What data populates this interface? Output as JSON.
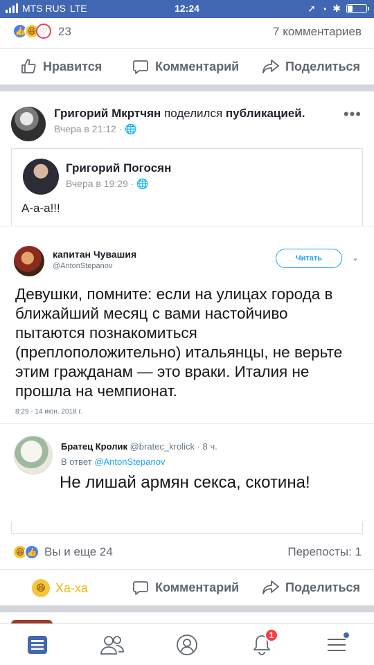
{
  "status_bar": {
    "carrier": "MTS RUS",
    "network": "LTE",
    "time": "12:24",
    "battery_level": 0.25
  },
  "top_reactions": {
    "count": "23",
    "comments": "7 комментариев"
  },
  "actions": {
    "like": "Нравится",
    "comment": "Комментарий",
    "share": "Поделиться"
  },
  "post": {
    "author": "Григорий Мкртчян",
    "shared_text": "поделился",
    "shared_object": "публикацией.",
    "time": "Вчера в 21:12 ·",
    "more": "•••",
    "original": {
      "author": "Григорий Погосян",
      "time": "Вчера в 19:29 ·",
      "text": "А-а-а!!!"
    }
  },
  "tweet": {
    "name": "капитан Чувашия",
    "handle": "@AntonStepanov",
    "follow_label": "Читать",
    "text": "Девушки, помните: если на улицах города в ближайший месяц с вами настойчиво пытаются познакомиться (преплоположительно) итальянцы, не верьте этим гражданам — это враки. Италия не прошла на чемпионат.",
    "date": "8:29 - 14 июн. 2018 г.",
    "reply": {
      "name": "Братец Кролик",
      "handle": "@bratec_krolick · 8 ч.",
      "reply_to_prefix": "В ответ",
      "reply_to": "@AntonStepanov",
      "text": "Не лишай армян секса, скотина!"
    }
  },
  "bottom": {
    "reacted": "Вы и еще 24",
    "reposts": "Перепосты: 1",
    "haha_label": "Ха-ха",
    "comment": "Комментарий",
    "share": "Поделиться"
  },
  "tabbar": {
    "notifications_badge": "1"
  },
  "colors": {
    "brand": "#4267b2",
    "twitter_blue": "#1da1f2",
    "haha": "#f0ba15",
    "badge": "#fa3e3e"
  }
}
